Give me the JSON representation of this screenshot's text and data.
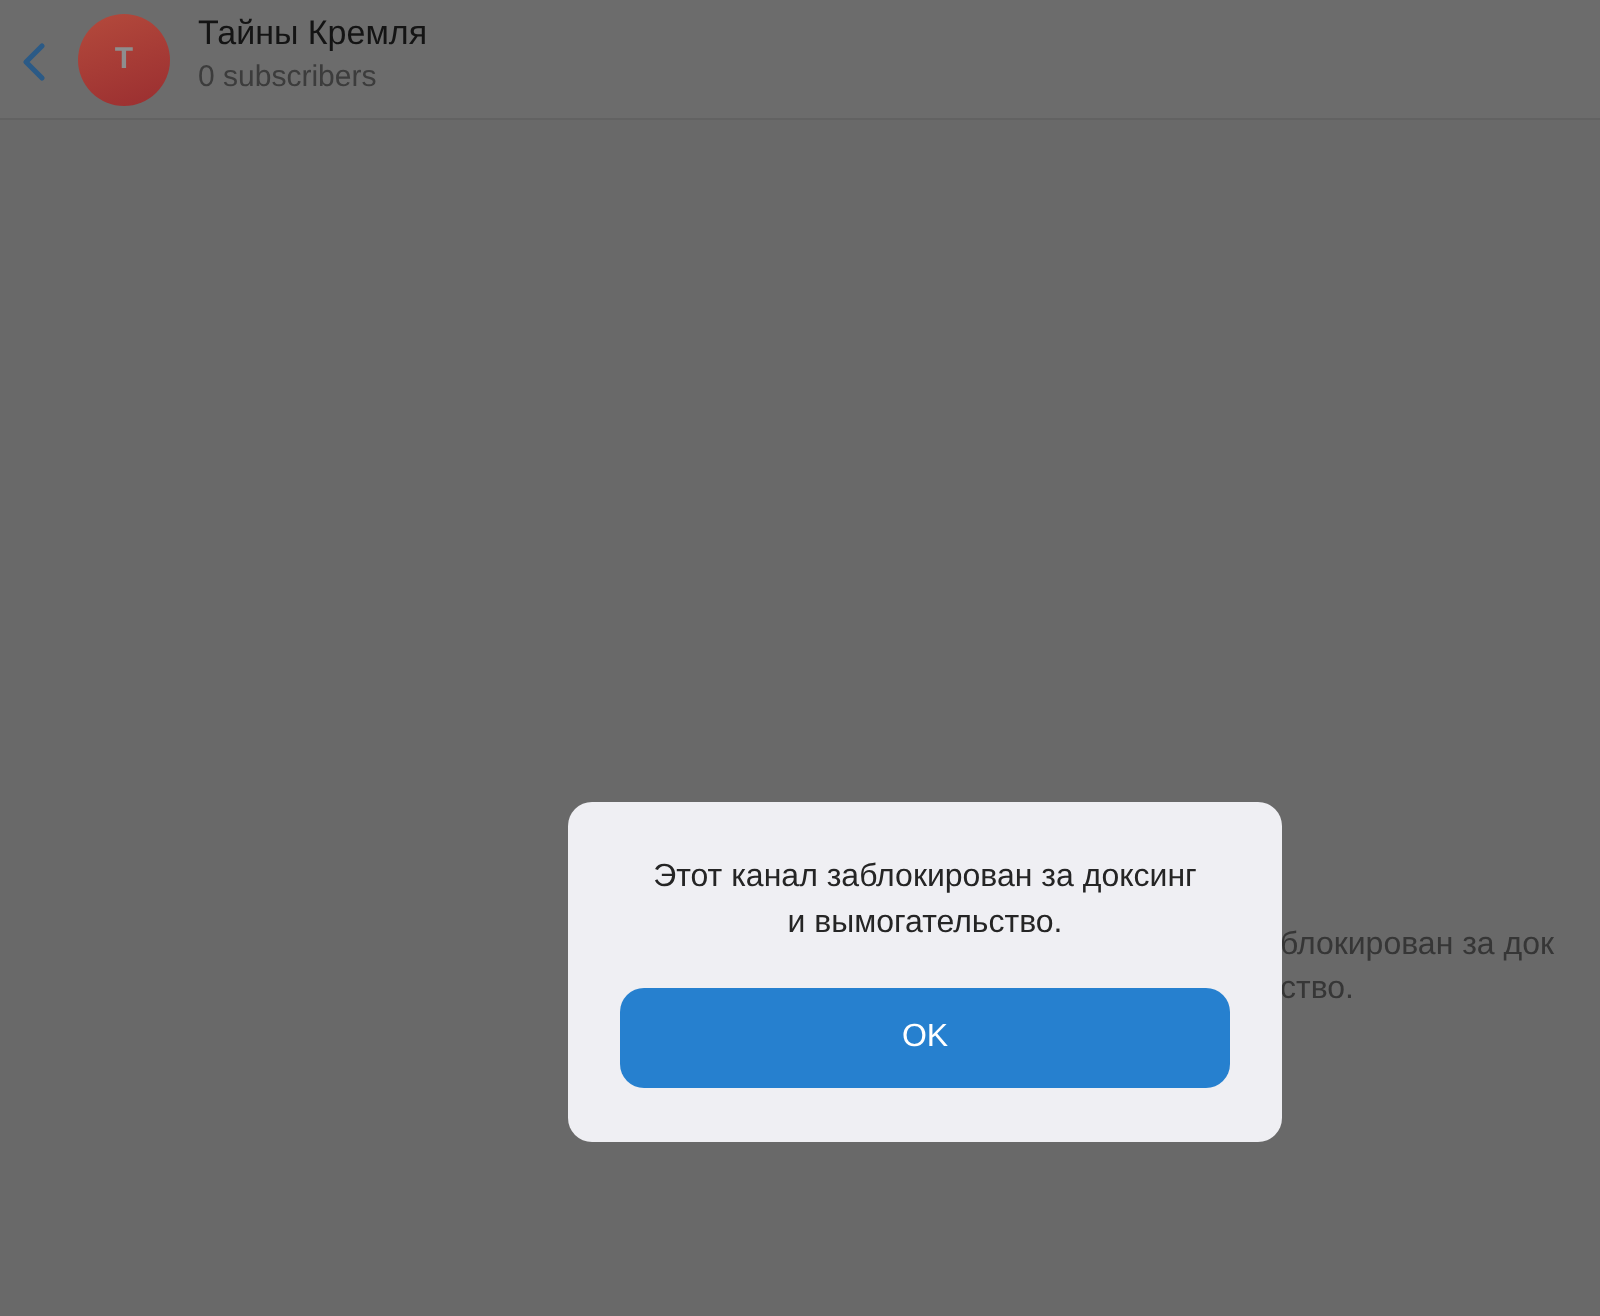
{
  "header": {
    "avatar": {
      "initial": "Т"
    },
    "title": "Тайны Кремля",
    "subtitle": "0 subscribers"
  },
  "background_message": {
    "lines": [
      "блокирован за док",
      "ство."
    ]
  },
  "dialog": {
    "message": "Этот канал заблокирован за доксинг и вымогательство.",
    "buttons": [
      {
        "label": "OK"
      }
    ]
  }
}
